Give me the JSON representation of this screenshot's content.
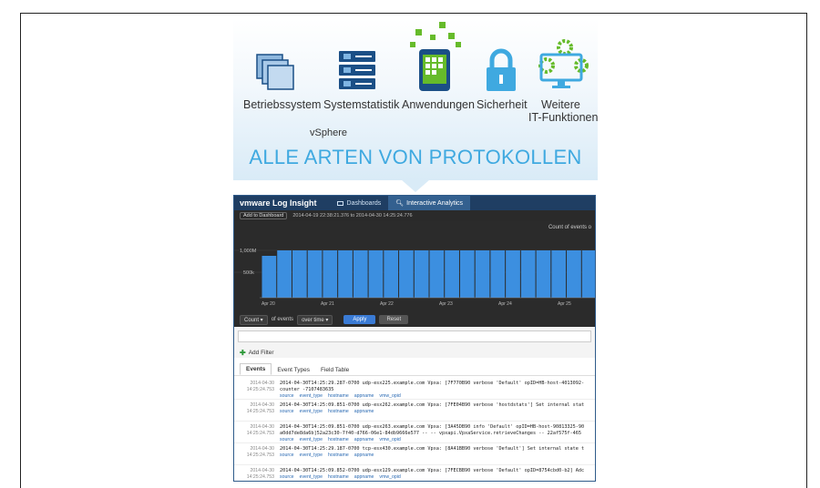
{
  "banner": {
    "title": "ALLE ARTEN VON PROTOKOLLEN",
    "categories": [
      {
        "label": "Betriebssystem",
        "icon": "stacked-windows-icon"
      },
      {
        "label": "Systemstatistik",
        "icon": "server-rack-icon"
      },
      {
        "label": "Anwendungen",
        "icon": "mobile-apps-icon"
      },
      {
        "label": "Sicherheit",
        "icon": "padlock-icon"
      },
      {
        "label_line1": "Weitere",
        "label_line2": "IT-Funktionen",
        "icon": "monitor-gears-icon"
      }
    ],
    "sublabel": "vSphere",
    "colors": {
      "accent": "#3fa9e0",
      "icon_dark": "#1b4f86",
      "icon_green": "#66bb2a"
    }
  },
  "app": {
    "brand_vm": "vm",
    "brand_ware": "ware",
    "brand_product": " Log Insight",
    "nav": [
      {
        "label": "Dashboards",
        "active": false
      },
      {
        "label": "Interactive Analytics",
        "active": true
      }
    ],
    "add_to_dashboard": "Add to Dashboard",
    "time_range": "2014-04-19 22:38:21.376 to 2014-04-30 14:25:24.776",
    "chart": {
      "title": "Count of events o",
      "ytick_1": "1,000M",
      "ytick_2": "500k",
      "xticks": [
        "Apr 20",
        "Apr 21",
        "Apr 22",
        "Apr 23",
        "Apr 24",
        "Apr 25"
      ]
    },
    "controls": {
      "count": "Count ▾",
      "of_events": "of events",
      "over_time": "over time ▾",
      "apply": "Apply",
      "reset": "Reset"
    },
    "add_filter": "Add Filter",
    "tabs": [
      {
        "label": "Events",
        "active": true
      },
      {
        "label": "Event Types",
        "active": false
      },
      {
        "label": "Field Table",
        "active": false
      }
    ],
    "events": [
      {
        "date": "2014-04-30",
        "time": "14:25:24.753",
        "line1": "2014-04-30T14:25:29.287-0700 udp-esx225.example.com Vpxa: [7F770B90 verbose 'Default' opID=HB-host-4013092-",
        "line2": "counter -7107483635",
        "fields": [
          "source",
          "event_type",
          "hostname",
          "appname",
          "vmw_opid"
        ]
      },
      {
        "date": "2014-04-30",
        "time": "14:25:24.753",
        "line1": "2014-04-30T14:25:09.851-0700 udp-esx262.example.com Vpxa: [7FE04B90 verbose 'hostdstats'] Set internal stat",
        "line2": "",
        "fields": [
          "source",
          "event_type",
          "hostname",
          "appname"
        ]
      },
      {
        "date": "2014-04-30",
        "time": "14:25:24.753",
        "line1": "2014-04-30T14:25:09.851-0700 udp-esx263.example.com Vpxa: [3A45DB90 info 'Default' opID=HB-host-90813325-90",
        "line2": "a0dd7de8da6b]52a23c30-7f40-d766-06e1-84db9666e577 -- -- vpxapi.VpxaService.retrieveChanges -- 22af575f-465",
        "fields": [
          "source",
          "event_type",
          "hostname",
          "appname",
          "vmw_opid"
        ]
      },
      {
        "date": "2014-04-30",
        "time": "14:25:24.753",
        "line1": "2014-04-30T14:25:29.187-0700 tcp-esx430.example.com Vpxa: [8A41BB90 verbose 'Default'] Set internal state t",
        "line2": "",
        "fields": [
          "source",
          "event_type",
          "hostname",
          "appname"
        ]
      },
      {
        "date": "2014-04-30",
        "time": "14:25:24.753",
        "line1": "2014-04-30T14:25:09.852-0700 udp-esx129.example.com Vpxa: [7FECBB90 verbose 'Default' opID=8754cbd0-b2] Adc",
        "line2": "",
        "fields": [
          "source",
          "event_type",
          "hostname",
          "appname",
          "vmw_opid"
        ]
      }
    ]
  }
}
